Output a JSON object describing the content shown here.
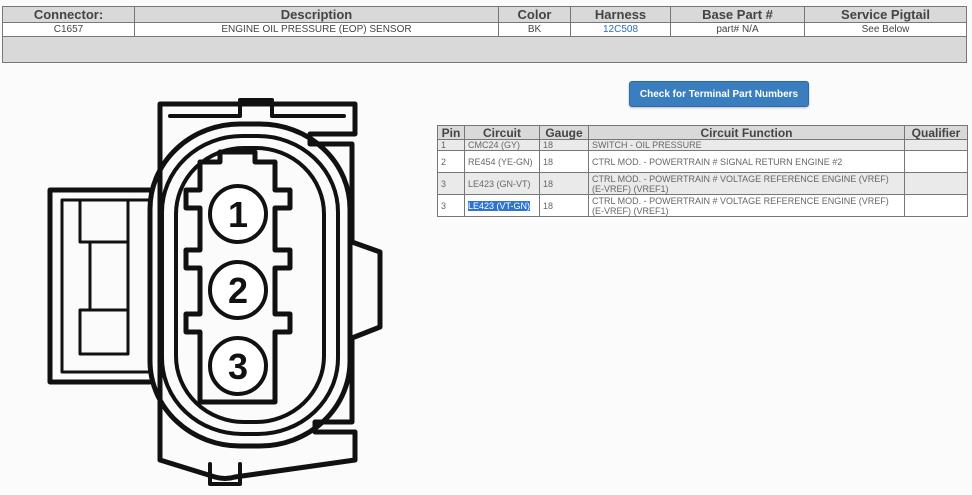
{
  "connector_table": {
    "headers": [
      "Connector:",
      "Description",
      "Color",
      "Harness",
      "Base Part #",
      "Service Pigtail"
    ],
    "row": {
      "connector": "C1657",
      "description": "ENGINE OIL PRESSURE (EOP) SENSOR",
      "color": "BK",
      "harness": "12C508",
      "base_part": "part# N/A",
      "service_pigtail": "See Below"
    }
  },
  "button": {
    "label": "Check for Terminal Part Numbers"
  },
  "pin_table": {
    "headers": [
      "Pin",
      "Circuit",
      "Gauge",
      "Circuit Function",
      "Qualifier"
    ],
    "rows": [
      {
        "pin": "1",
        "circuit": "CMC24 (GY)",
        "gauge": "18",
        "function": "SWITCH - OIL PRESSURE",
        "qualifier": ""
      },
      {
        "pin": "2",
        "circuit": "RE454 (YE-GN)",
        "gauge": "18",
        "function": "CTRL MOD. - POWERTRAIN # SIGNAL RETURN ENGINE #2",
        "qualifier": ""
      },
      {
        "pin": "3",
        "circuit": "LE423 (GN-VT)",
        "gauge": "18",
        "function": "CTRL MOD. - POWERTRAIN # VOLTAGE REFERENCE ENGINE (VREF) (E-VREF) (VREF1)",
        "qualifier": ""
      },
      {
        "pin": "3",
        "circuit": "LE423 (VT-GN)",
        "gauge": "18",
        "function": "CTRL MOD. - POWERTRAIN # VOLTAGE REFERENCE ENGINE (VREF) (E-VREF) (VREF1)",
        "qualifier": ""
      }
    ]
  },
  "diagram": {
    "pin_labels": [
      "1",
      "2",
      "3"
    ]
  }
}
